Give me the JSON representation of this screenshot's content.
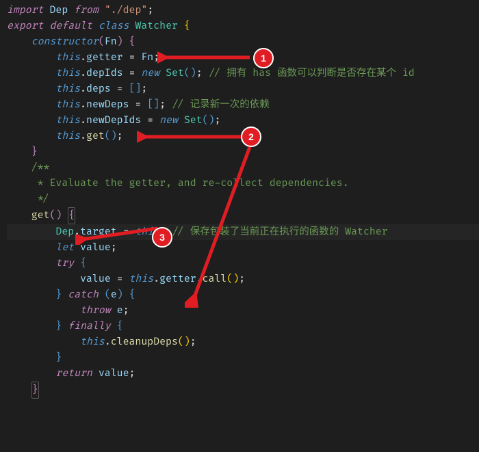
{
  "accent": "#e11d24",
  "annotations": {
    "badge1": "1",
    "badge2": "2",
    "badge3": "3"
  },
  "code": {
    "l1": {
      "import": "import",
      "dep": "Dep",
      "from": "from",
      "path": "\"./dep\"",
      "semi": ";"
    },
    "l2": {
      "export": "export",
      "default": "default",
      "class": "class",
      "name": "Watcher",
      "brace": "{"
    },
    "l3": {
      "ctor": "constructor",
      "p": "(",
      "param": "Fn",
      "p2": ")",
      "brace": "{"
    },
    "l4": {
      "this": "this",
      "dot": ".",
      "prop": "getter",
      "eq": " = ",
      "rhs": "Fn",
      "semi": ";"
    },
    "l5": {
      "this": "this",
      "dot": ".",
      "prop": "depIds",
      "eq": " = ",
      "new": "new",
      "set": "Set",
      "call": "()",
      "semi": ";",
      "cmt": " // 拥有 has 函数可以判断是否存在某个 id"
    },
    "l6": {
      "this": "this",
      "dot": ".",
      "prop": "deps",
      "eq": " = ",
      "arr": "[]",
      "semi": ";"
    },
    "l7": {
      "this": "this",
      "dot": ".",
      "prop": "newDeps",
      "eq": " = ",
      "arr": "[]",
      "semi": ";",
      "cmt": " // 记录新一次的依赖"
    },
    "l8": {
      "this": "this",
      "dot": ".",
      "prop": "newDepIds",
      "eq": " = ",
      "new": "new",
      "set": "Set",
      "call": "()",
      "semi": ";"
    },
    "l9": {
      "this": "this",
      "dot": ".",
      "fn": "get",
      "call": "()",
      "semi": ";"
    },
    "l10": {
      "brace": "}"
    },
    "l11": {
      "blank": ""
    },
    "l12": {
      "cmt": "/**"
    },
    "l13": {
      "cmt": " * Evaluate the getter, and re-collect dependencies."
    },
    "l14": {
      "cmt": " */"
    },
    "l15": {
      "fn": "get",
      "p": "()",
      "brace": "{"
    },
    "l16": {
      "cls": "Dep",
      "dot": ".",
      "prop": "target",
      "eq": " = ",
      "this": "this",
      "semi": ";",
      "cmt": " // 保存包装了当前正在执行的函数的 Watcher"
    },
    "l17": {
      "let": "let",
      "var": "value",
      "semi": ";"
    },
    "l18": {
      "try": "try",
      "brace": "{"
    },
    "l19": {
      "lhs": "value",
      "eq": " = ",
      "this": "this",
      "dot": ".",
      "prop": "getter",
      "dot2": ".",
      "fn": "call",
      "call": "()",
      "semi": ";"
    },
    "l20": {
      "brace": "}",
      "catch": "catch",
      "p": "(",
      "param": "e",
      "p2": ")",
      "brace2": "{"
    },
    "l21": {
      "throw": "throw",
      "var": "e",
      "semi": ";"
    },
    "l22": {
      "brace": "}",
      "finally": "finally",
      "brace2": "{"
    },
    "l23": {
      "this": "this",
      "dot": ".",
      "fn": "cleanupDeps",
      "call": "()",
      "semi": ";"
    },
    "l24": {
      "brace": "}"
    },
    "l25": {
      "ret": "return",
      "var": "value",
      "semi": ";"
    },
    "l26": {
      "brace": "}"
    }
  }
}
